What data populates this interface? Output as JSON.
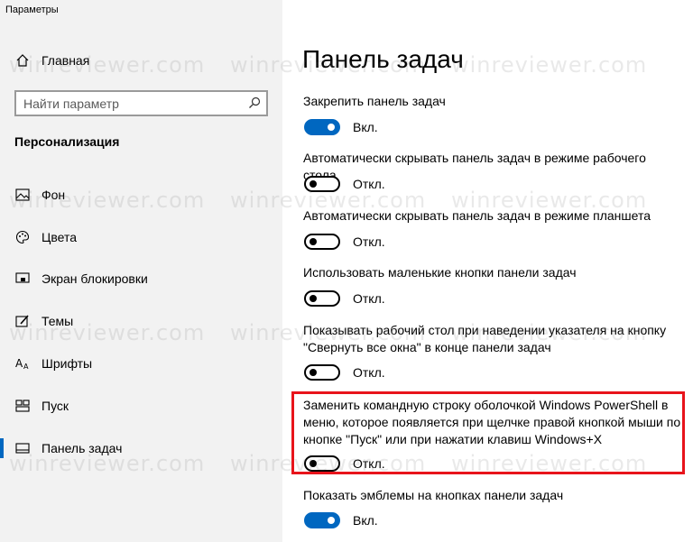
{
  "window": {
    "title": "Параметры"
  },
  "sidebar": {
    "home_label": "Главная",
    "search_placeholder": "Найти параметр",
    "section_title": "Персонализация",
    "items": [
      {
        "label": "Фон",
        "icon": "picture-icon"
      },
      {
        "label": "Цвета",
        "icon": "palette-icon"
      },
      {
        "label": "Экран блокировки",
        "icon": "lock-screen-icon"
      },
      {
        "label": "Темы",
        "icon": "brush-icon"
      },
      {
        "label": "Шрифты",
        "icon": "fonts-icon"
      },
      {
        "label": "Пуск",
        "icon": "start-icon"
      },
      {
        "label": "Панель задач",
        "icon": "taskbar-icon",
        "active": true
      }
    ]
  },
  "main": {
    "page_title": "Панель задач",
    "settings": [
      {
        "label": "Закрепить панель задач",
        "state": "Вкл.",
        "on": true
      },
      {
        "label": "Автоматически скрывать панель задач в режиме рабочего стола",
        "state": "Откл.",
        "on": false
      },
      {
        "label": "Автоматически скрывать панель задач в режиме планшета",
        "state": "Откл.",
        "on": false
      },
      {
        "label": "Использовать маленькие кнопки панели задач",
        "state": "Откл.",
        "on": false
      },
      {
        "label": "Показывать рабочий стол при наведении указателя на кнопку \"Свернуть все окна\" в конце панели задач",
        "state": "Откл.",
        "on": false
      },
      {
        "label": "Заменить командную строку оболочкой Windows PowerShell в меню, которое появляется при щелчке правой кнопкой мыши по кнопке \"Пуск\" или при нажатии клавиш Windows+X",
        "state": "Откл.",
        "on": false
      },
      {
        "label": "Показать эмблемы на кнопках панели задач",
        "state": "Вкл.",
        "on": true
      }
    ]
  },
  "watermark": {
    "text": "winreviewer.com"
  },
  "colors": {
    "accent": "#0067c0",
    "highlight": "#e8141b",
    "sidebar_bg": "#f2f2f2"
  }
}
